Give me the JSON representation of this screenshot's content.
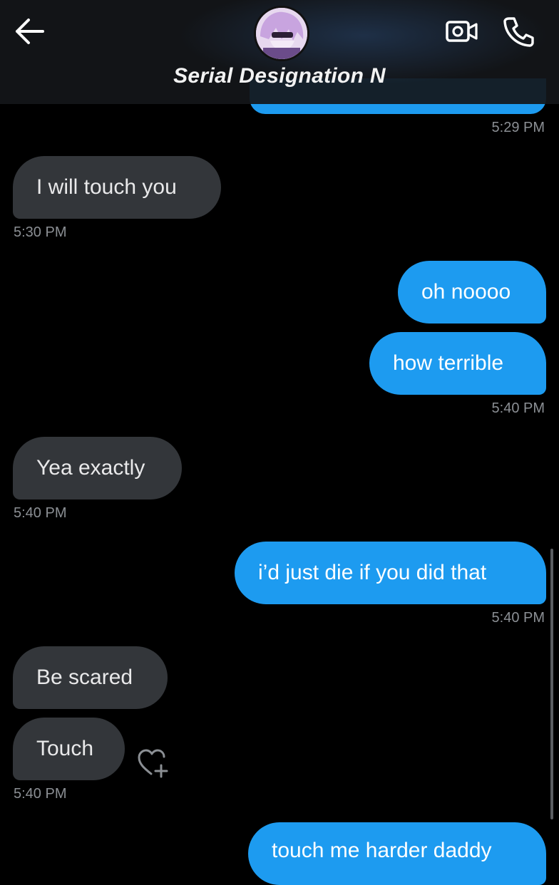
{
  "header": {
    "title": "Serial Designation N",
    "icons": {
      "back": "arrow-left-icon",
      "video": "video-camera-icon",
      "call": "phone-icon"
    }
  },
  "messages": [
    {
      "id": "m1",
      "direction": "incoming",
      "text": "I will touch you",
      "time": "5:30 PM"
    },
    {
      "id": "m2",
      "direction": "outgoing",
      "text": "oh noooo"
    },
    {
      "id": "m3",
      "direction": "outgoing",
      "text": "how terrible",
      "time": "5:40 PM"
    },
    {
      "id": "m4",
      "direction": "incoming",
      "text": "Yea exactly",
      "time": "5:40 PM"
    },
    {
      "id": "m5",
      "direction": "outgoing",
      "text": "i’d just die if you did that",
      "time": "5:40 PM"
    },
    {
      "id": "m6",
      "direction": "incoming",
      "text": "Be scared"
    },
    {
      "id": "m7",
      "direction": "incoming",
      "text": "Touch",
      "time": "5:40 PM"
    },
    {
      "id": "m8",
      "direction": "outgoing",
      "text": "touch me harder daddy"
    }
  ],
  "top_timestamp": "5:29 PM",
  "reaction_icon": "heart-plus-icon",
  "colors": {
    "background": "#000000",
    "outgoing_bubble": "#1d9bf0",
    "incoming_bubble": "#33363a",
    "timestamp": "#8b8f94"
  }
}
